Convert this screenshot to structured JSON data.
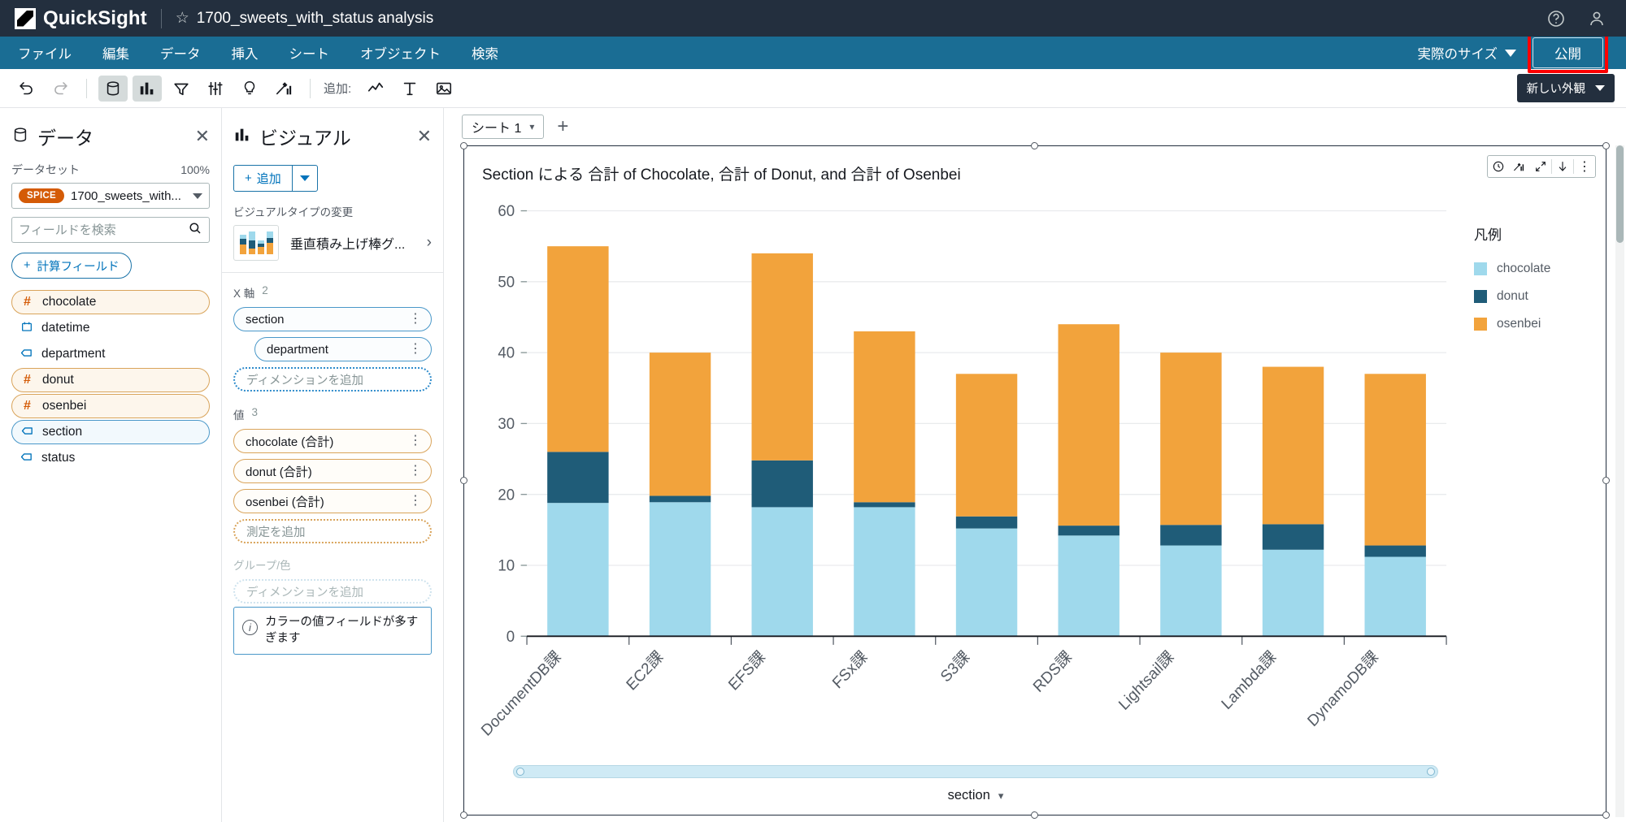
{
  "app": {
    "name": "QuickSight",
    "analysis_title": "1700_sweets_with_status analysis",
    "star_icon": "star-outline-icon",
    "help_icon": "help-circle-icon",
    "account_icon": "user-account-icon"
  },
  "menubar": {
    "items": [
      "ファイル",
      "編集",
      "データ",
      "挿入",
      "シート",
      "オブジェクト",
      "検索"
    ],
    "size_selector": "実際のサイズ",
    "publish_label": "公開",
    "publish_highlight_color": "#ff0000"
  },
  "toolbar": {
    "undo": "元に戻す",
    "redo": "やり直し",
    "data_icon": "database-icon",
    "visual_icon": "bar-chart-icon",
    "filter_icon": "filter-funnel-icon",
    "parameter_icon": "sliders-icon",
    "action_icon": "lightbulb-icon",
    "insight_icon": "magic-wand-chart-icon",
    "add_label": "追加:",
    "add_line_icon": "line-chart-icon",
    "add_text_icon": "text-icon",
    "add_image_icon": "image-icon",
    "appearance_label": "新しい外観"
  },
  "data_panel": {
    "title": "データ",
    "icon": "database-icon",
    "close_icon": "close-icon",
    "dataset_label": "データセット",
    "zoom_percent": "100%",
    "dataset_badge": "SPICE",
    "dataset_name": "1700_sweets_with...",
    "search_placeholder": "フィールドを検索",
    "search_value": "",
    "search_icon": "search-icon",
    "calc_field_label": "計算フィールド",
    "fields": [
      {
        "name": "chocolate",
        "type": "number",
        "icon": "hash-icon",
        "state": "measure"
      },
      {
        "name": "datetime",
        "type": "date",
        "icon": "calendar-icon",
        "state": "none"
      },
      {
        "name": "department",
        "type": "string",
        "icon": "tag-icon",
        "state": "none"
      },
      {
        "name": "donut",
        "type": "number",
        "icon": "hash-icon",
        "state": "measure"
      },
      {
        "name": "osenbei",
        "type": "number",
        "icon": "hash-icon",
        "state": "measure"
      },
      {
        "name": "section",
        "type": "string",
        "icon": "tag-icon",
        "state": "dimension"
      },
      {
        "name": "status",
        "type": "string",
        "icon": "tag-icon",
        "state": "none"
      }
    ]
  },
  "visual_panel": {
    "title": "ビジュアル",
    "icon": "bar-chart-icon",
    "close_icon": "close-icon",
    "add_label": "追加",
    "change_type_label": "ビジュアルタイプの変更",
    "visual_type_name": "垂直積み上げ棒グ...",
    "wells": {
      "x_axis": {
        "label": "X 軸",
        "count": "2",
        "fields": [
          "section",
          "department"
        ],
        "placeholder": "ディメンションを追加"
      },
      "value": {
        "label": "値",
        "count": "3",
        "fields": [
          "chocolate (合計)",
          "donut (合計)",
          "osenbei (合計)"
        ],
        "placeholder": "測定を追加"
      },
      "group_color": {
        "label": "グループ/色",
        "placeholder": "ディメンションを追加",
        "warning": "カラーの値フィールドが多すぎます",
        "warning_icon": "info-icon"
      }
    }
  },
  "sheet": {
    "tab_label": "シート 1",
    "tab_caret_icon": "chevron-down-icon",
    "add_sheet_icon": "plus-icon"
  },
  "visual": {
    "title": "Section による 合計 of Chocolate, 合計 of Donut, and 合計 of Osenbei",
    "menu_icons": [
      "clock-insight-icon",
      "magic-chart-icon",
      "expand-arrows-icon",
      "download-arrow-icon",
      "kebab-menu-icon"
    ],
    "legend_title": "凡例",
    "x_axis_footer": "section",
    "x_axis_footer_icon": "chevron-down-icon",
    "scrollbar_name": "horizontal-scrollbar"
  },
  "chart_data": {
    "type": "bar",
    "stacked": true,
    "title": "Section による 合計 of Chocolate, 合計 of Donut, and 合計 of Osenbei",
    "xlabel": "section",
    "ylabel": "",
    "ylim": [
      0,
      60
    ],
    "yticks": [
      0,
      10,
      20,
      30,
      40,
      50,
      60
    ],
    "grid": true,
    "legend_position": "right",
    "categories": [
      "DocumentDB課",
      "EC2課",
      "EFS課",
      "FSx課",
      "S3課",
      "RDS課",
      "Lightsail課",
      "Lambda課",
      "DynamoDB課"
    ],
    "series": [
      {
        "name": "chocolate",
        "color": "#9FD9EC",
        "values": [
          18.8,
          18.9,
          18.2,
          18.2,
          15.2,
          14.2,
          12.8,
          12.2,
          11.2
        ]
      },
      {
        "name": "donut",
        "color": "#1F5C78",
        "values": [
          7.2,
          0.9,
          6.6,
          0.7,
          1.7,
          1.4,
          2.9,
          3.6,
          1.6
        ]
      },
      {
        "name": "osenbei",
        "color": "#F2A33C",
        "values": [
          29.0,
          20.2,
          29.2,
          24.1,
          20.1,
          28.4,
          24.3,
          22.2,
          24.2
        ]
      }
    ],
    "totals": [
      55.0,
      40.0,
      54.0,
      43.0,
      37.0,
      44.0,
      40.0,
      38.0,
      37.0
    ]
  }
}
